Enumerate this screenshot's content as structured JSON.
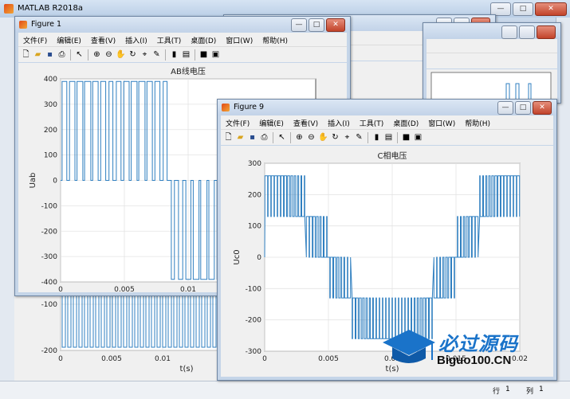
{
  "matlab": {
    "title": "MATLAB R2018a",
    "status": {
      "row_label": "行",
      "row": "1",
      "col_label": "列",
      "col": "1"
    }
  },
  "menus": [
    "文件(F)",
    "编辑(E)",
    "查看(V)",
    "插入(I)",
    "工具(T)",
    "桌面(D)",
    "窗口(W)",
    "帮助(H)"
  ],
  "window_buttons": {
    "min": "—",
    "max": "□",
    "close": "✕"
  },
  "figure1": {
    "title": "Figure 1",
    "chart_data": {
      "type": "line",
      "title": "AB线电压",
      "xlabel": "t(s)",
      "ylabel": "Uab",
      "xlim": [
        0,
        0.02
      ],
      "ylim": [
        -400,
        400
      ],
      "xticks": [
        "0",
        "0.005",
        "0.01"
      ],
      "yticks": [
        "400",
        "300",
        "200",
        "100",
        "0",
        "-100",
        "-200",
        "-300",
        "-400"
      ],
      "series": [
        {
          "values": "PWM pulses: 0/+390 for t<0.0085, 0/-390 for 0.0085<t<0.017"
        }
      ]
    }
  },
  "figure9": {
    "title": "Figure 9",
    "chart_data": {
      "type": "line",
      "title": "C相电压",
      "xlabel": "t(s)",
      "ylabel": "Uc0",
      "xlim": [
        0,
        0.02
      ],
      "ylim": [
        -300,
        300
      ],
      "xticks": [
        "0",
        "0.005",
        "0.01",
        "0.015",
        "0.02"
      ],
      "yticks": [
        "300",
        "200",
        "100",
        "0",
        "-100",
        "-200",
        "-300"
      ],
      "series": [
        {
          "values": "multilevel PWM steps at 0, ±130, ±260"
        }
      ]
    }
  },
  "lower_chart": {
    "xlabel": "t(s)",
    "xticks": [
      "0",
      "0.005",
      "0.01"
    ],
    "yticks": [
      "-100",
      "-200"
    ]
  },
  "watermark": {
    "cn": "必过源码",
    "url": "Biguo100.CN"
  }
}
